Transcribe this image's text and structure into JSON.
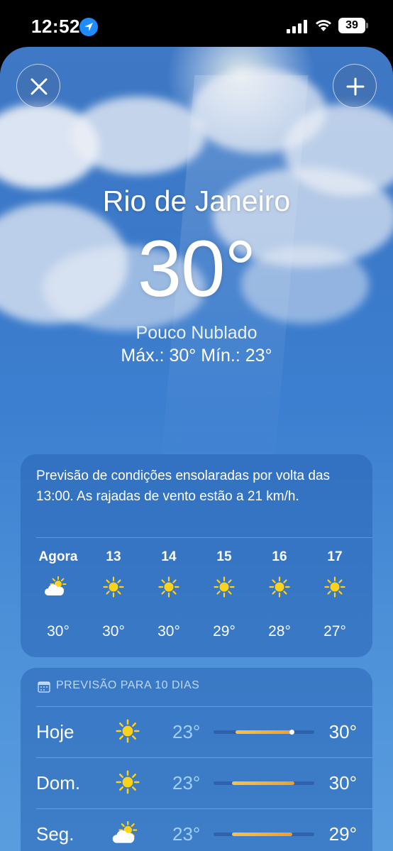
{
  "status_bar": {
    "time": "12:52",
    "battery": "39",
    "icons": [
      "location-arrow-icon",
      "signal-icon",
      "wifi-icon",
      "battery-icon"
    ]
  },
  "header": {
    "close_icon": "close-icon",
    "add_icon": "plus-icon"
  },
  "current": {
    "city": "Rio de Janeiro",
    "temperature": "30°",
    "condition": "Pouco Nublado",
    "hilo": "Máx.: 30°  Mín.: 23°"
  },
  "hourly": {
    "summary": "Previsão de condições ensolaradas por volta das 13:00. As rajadas de vento estão a 21 km/h.",
    "items": [
      {
        "time": "Agora",
        "icon": "partly-cloudy-icon",
        "temp": "30°"
      },
      {
        "time": "13",
        "icon": "sun-icon",
        "temp": "30°"
      },
      {
        "time": "14",
        "icon": "sun-icon",
        "temp": "30°"
      },
      {
        "time": "15",
        "icon": "sun-icon",
        "temp": "29°"
      },
      {
        "time": "16",
        "icon": "sun-icon",
        "temp": "28°"
      },
      {
        "time": "17",
        "icon": "sun-icon",
        "temp": "27°"
      }
    ]
  },
  "daily": {
    "header": "PREVISÃO PARA 10 DIAS",
    "header_icon": "calendar-icon",
    "days": [
      {
        "day": "Hoje",
        "icon": "sun-icon",
        "low": "23°",
        "high": "30°",
        "range_start": 0.22,
        "range_end": 0.78,
        "current_marker": 0.78
      },
      {
        "day": "Dom.",
        "icon": "sun-icon",
        "low": "23°",
        "high": "30°",
        "range_start": 0.18,
        "range_end": 0.8
      },
      {
        "day": "Seg.",
        "icon": "partly-cloudy-icon",
        "low": "23°",
        "high": "29°",
        "range_start": 0.18,
        "range_end": 0.78
      }
    ]
  },
  "colors": {
    "sky_top": "#3f78c4",
    "sky_bottom": "#5a9ddf",
    "sun_yellow": "#ffd21a",
    "low_temp": "#9fd0ff",
    "bar_gradient_start": "#f7c24a",
    "bar_gradient_end": "#f39c2c"
  }
}
